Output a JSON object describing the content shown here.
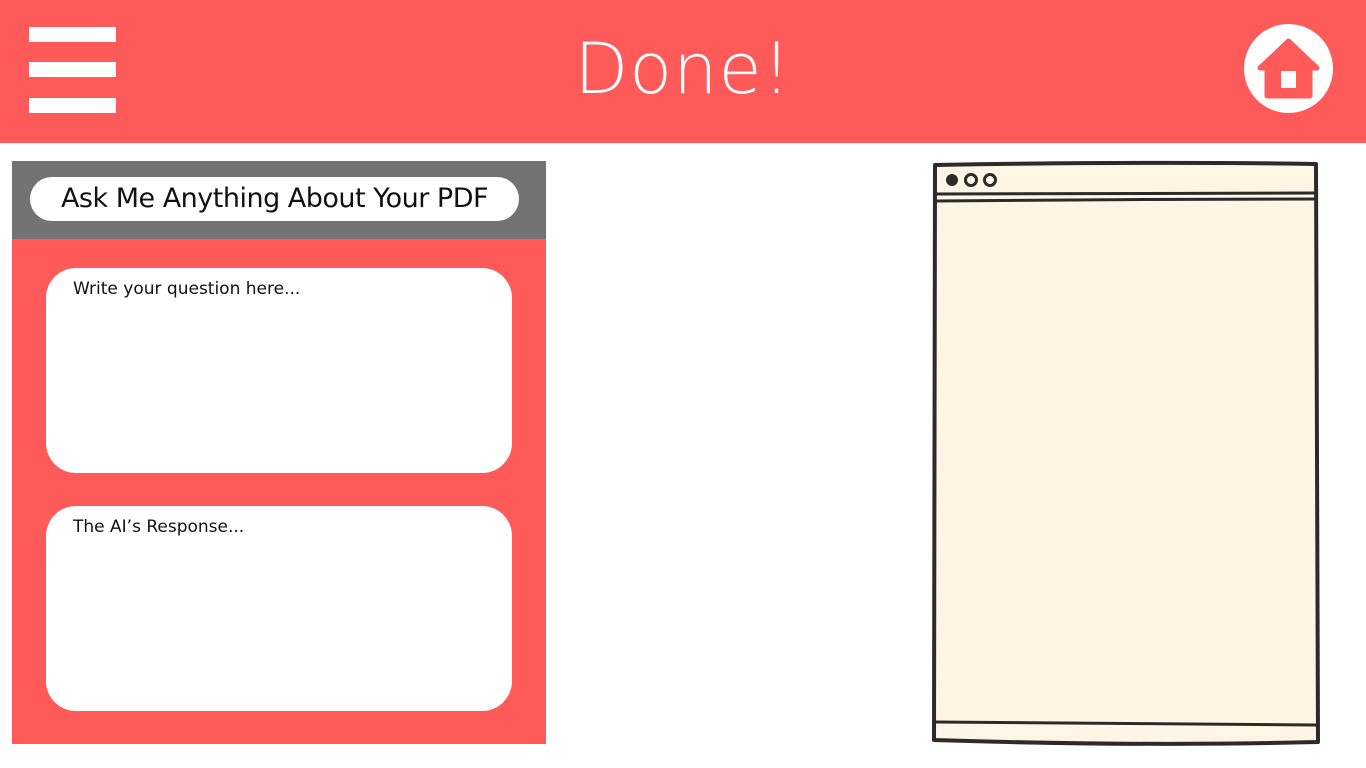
{
  "header": {
    "title": "Done!",
    "menu_icon": "hamburger-menu-icon",
    "home_icon": "home-icon"
  },
  "chat": {
    "title": "Ask Me Anything About Your PDF",
    "question_placeholder": "Write your question here...",
    "response_text": "The AI’s Response..."
  },
  "viewer": {
    "window_icon": "browser-window-illustration"
  },
  "colors": {
    "accent": "#FF5A5A",
    "header_gray": "#737373",
    "viewer_fill": "#FFF5E4",
    "viewer_stroke": "#2B2B2B",
    "text": "#111111",
    "white": "#FFFFFF"
  }
}
